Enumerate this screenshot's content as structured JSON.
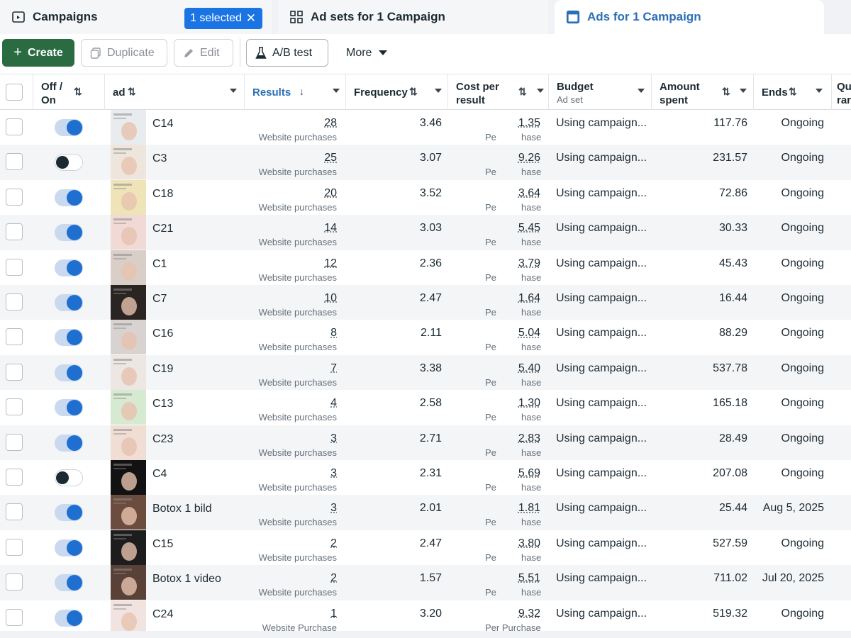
{
  "tabs": {
    "campaigns": "Campaigns",
    "selected_pill": "1 selected",
    "adsets": "Ad sets for 1 Campaign",
    "ads": "Ads for 1 Campaign"
  },
  "toolbar": {
    "create": "Create",
    "duplicate": "Duplicate",
    "edit": "Edit",
    "ab_test": "A/B test",
    "more": "More"
  },
  "columns": {
    "off_on": [
      "Off /",
      "On"
    ],
    "ad": "ad",
    "results": "Results",
    "frequency": "Frequency",
    "cost_per_result": [
      "Cost per",
      "result"
    ],
    "budget": "Budget",
    "budget_sub": "Ad set",
    "amount_spent": [
      "Amount",
      "spent"
    ],
    "ends": "Ends",
    "partial": [
      "Qu",
      "rar"
    ]
  },
  "rows": [
    {
      "on": true,
      "name": "C14",
      "results": "28",
      "results_label": "Website purchases",
      "frequency": "3.46",
      "cost": "1.35",
      "cost_prefix": "Pe",
      "cost_suffix": "hase",
      "budget": "Using campaign...",
      "spent": "117.76",
      "ends": "Ongoing",
      "thumb": "#e9ecef"
    },
    {
      "on": false,
      "name": "C3",
      "results": "25",
      "results_label": "Website purchases",
      "frequency": "3.07",
      "cost": "9.26",
      "cost_prefix": "Pe",
      "cost_suffix": "hase",
      "budget": "Using campaign...",
      "spent": "231.57",
      "ends": "Ongoing",
      "thumb": "#eee6dc"
    },
    {
      "on": true,
      "name": "C18",
      "results": "20",
      "results_label": "Website purchases",
      "frequency": "3.52",
      "cost": "3.64",
      "cost_prefix": "Pe",
      "cost_suffix": "hase",
      "budget": "Using campaign...",
      "spent": "72.86",
      "ends": "Ongoing",
      "thumb": "#efe4b8"
    },
    {
      "on": true,
      "name": "C21",
      "results": "14",
      "results_label": "Website purchases",
      "frequency": "3.03",
      "cost": "5.45",
      "cost_prefix": "Pe",
      "cost_suffix": "hase",
      "budget": "Using campaign...",
      "spent": "30.33",
      "ends": "Ongoing",
      "thumb": "#f1d9d6"
    },
    {
      "on": true,
      "name": "C1",
      "results": "12",
      "results_label": "Website purchases",
      "frequency": "2.36",
      "cost": "3.79",
      "cost_prefix": "Pe",
      "cost_suffix": "hase",
      "budget": "Using campaign...",
      "spent": "45.43",
      "ends": "Ongoing",
      "thumb": "#d9cfc8"
    },
    {
      "on": true,
      "name": "C7",
      "results": "10",
      "results_label": "Website purchases",
      "frequency": "2.47",
      "cost": "1.64",
      "cost_prefix": "Pe",
      "cost_suffix": "hase",
      "budget": "Using campaign...",
      "spent": "16.44",
      "ends": "Ongoing",
      "thumb": "#2a2523"
    },
    {
      "on": true,
      "name": "C16",
      "results": "8",
      "results_label": "Website purchases",
      "frequency": "2.11",
      "cost": "5.04",
      "cost_prefix": "Pe",
      "cost_suffix": "hase",
      "budget": "Using campaign...",
      "spent": "88.29",
      "ends": "Ongoing",
      "thumb": "#d8d3d0"
    },
    {
      "on": true,
      "name": "C19",
      "results": "7",
      "results_label": "Website purchases",
      "frequency": "3.38",
      "cost": "5.40",
      "cost_prefix": "Pe",
      "cost_suffix": "hase",
      "budget": "Using campaign...",
      "spent": "537.78",
      "ends": "Ongoing",
      "thumb": "#ece7e3"
    },
    {
      "on": true,
      "name": "C13",
      "results": "4",
      "results_label": "Website purchases",
      "frequency": "2.58",
      "cost": "1.30",
      "cost_prefix": "Pe",
      "cost_suffix": "hase",
      "budget": "Using campaign...",
      "spent": "165.18",
      "ends": "Ongoing",
      "thumb": "#d6ead2"
    },
    {
      "on": true,
      "name": "C23",
      "results": "3",
      "results_label": "Website purchases",
      "frequency": "2.71",
      "cost": "2.83",
      "cost_prefix": "Pe",
      "cost_suffix": "hase",
      "budget": "Using campaign...",
      "spent": "28.49",
      "ends": "Ongoing",
      "thumb": "#f0ddd4"
    },
    {
      "on": false,
      "name": "C4",
      "results": "3",
      "results_label": "Website purchases",
      "frequency": "2.31",
      "cost": "5.69",
      "cost_prefix": "Pe",
      "cost_suffix": "hase",
      "budget": "Using campaign...",
      "spent": "207.08",
      "ends": "Ongoing",
      "thumb": "#121212"
    },
    {
      "on": true,
      "name": "Botox 1 bild",
      "results": "3",
      "results_label": "Website purchases",
      "frequency": "2.01",
      "cost": "1.81",
      "cost_prefix": "Pe",
      "cost_suffix": "hase",
      "budget": "Using campaign...",
      "spent": "25.44",
      "ends": "Aug 5, 2025",
      "thumb": "#6b4c3f"
    },
    {
      "on": true,
      "name": "C15",
      "results": "2",
      "results_label": "Website purchases",
      "frequency": "2.47",
      "cost": "3.80",
      "cost_prefix": "Pe",
      "cost_suffix": "hase",
      "budget": "Using campaign...",
      "spent": "527.59",
      "ends": "Ongoing",
      "thumb": "#1d1d1d"
    },
    {
      "on": true,
      "name": "Botox 1 video",
      "results": "2",
      "results_label": "Website purchases",
      "frequency": "1.57",
      "cost": "5.51",
      "cost_prefix": "Pe",
      "cost_suffix": "hase",
      "budget": "Using campaign...",
      "spent": "711.02",
      "ends": "Jul 20, 2025",
      "thumb": "#5a4137"
    },
    {
      "on": true,
      "name": "C24",
      "results": "1",
      "results_label": "Website Purchase",
      "frequency": "3.20",
      "cost": "9.32",
      "cost_prefix": "Per Purchase",
      "cost_suffix": "",
      "budget": "Using campaign...",
      "spent": "519.32",
      "ends": "Ongoing",
      "thumb": "#f1e3df"
    }
  ],
  "colors": {
    "create_bg": "#2a6b41",
    "selected_pill": "#1b74e4",
    "toggle_on": "#1e6fd0",
    "active_tab_text": "#2d6fb5"
  }
}
